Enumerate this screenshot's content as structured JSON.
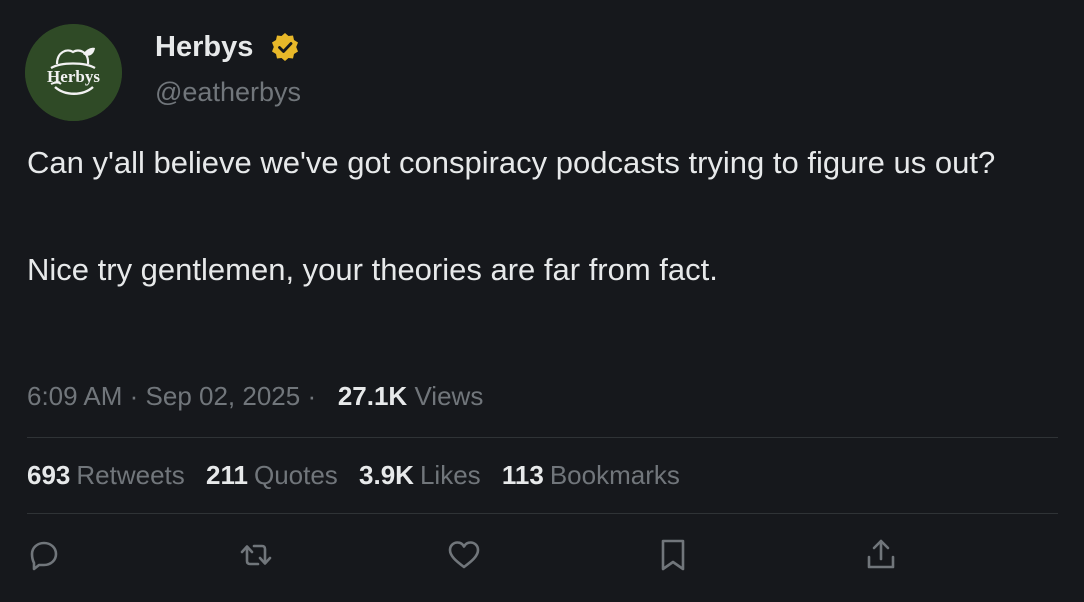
{
  "account": {
    "display_name": "Herbys",
    "handle": "@eatherbys",
    "avatar_text": "Herbys",
    "avatar_color": "#2f4a26",
    "verified_color": "#e8b829"
  },
  "tweet": {
    "paragraph_1": "Can y'all believe we've got conspiracy podcasts trying to figure us out?",
    "paragraph_2": "Nice try gentlemen, your theories are far from fact.",
    "time": "6:09 AM",
    "date": "Sep 02, 2025",
    "views_count": "27.1K",
    "views_label": "Views"
  },
  "stats": {
    "retweets_count": "693",
    "retweets_label": "Retweets",
    "quotes_count": "211",
    "quotes_label": "Quotes",
    "likes_count": "3.9K",
    "likes_label": "Likes",
    "bookmarks_count": "113",
    "bookmarks_label": "Bookmarks"
  },
  "actions": [
    {
      "name": "reply",
      "icon": "reply-icon"
    },
    {
      "name": "retweet",
      "icon": "retweet-icon"
    },
    {
      "name": "like",
      "icon": "heart-icon"
    },
    {
      "name": "bookmark",
      "icon": "bookmark-icon"
    },
    {
      "name": "share",
      "icon": "share-icon"
    }
  ],
  "colors": {
    "background": "#16181c",
    "primary_text": "#e7e9ea",
    "secondary_text": "#71767b",
    "divider": "#2f3336"
  }
}
